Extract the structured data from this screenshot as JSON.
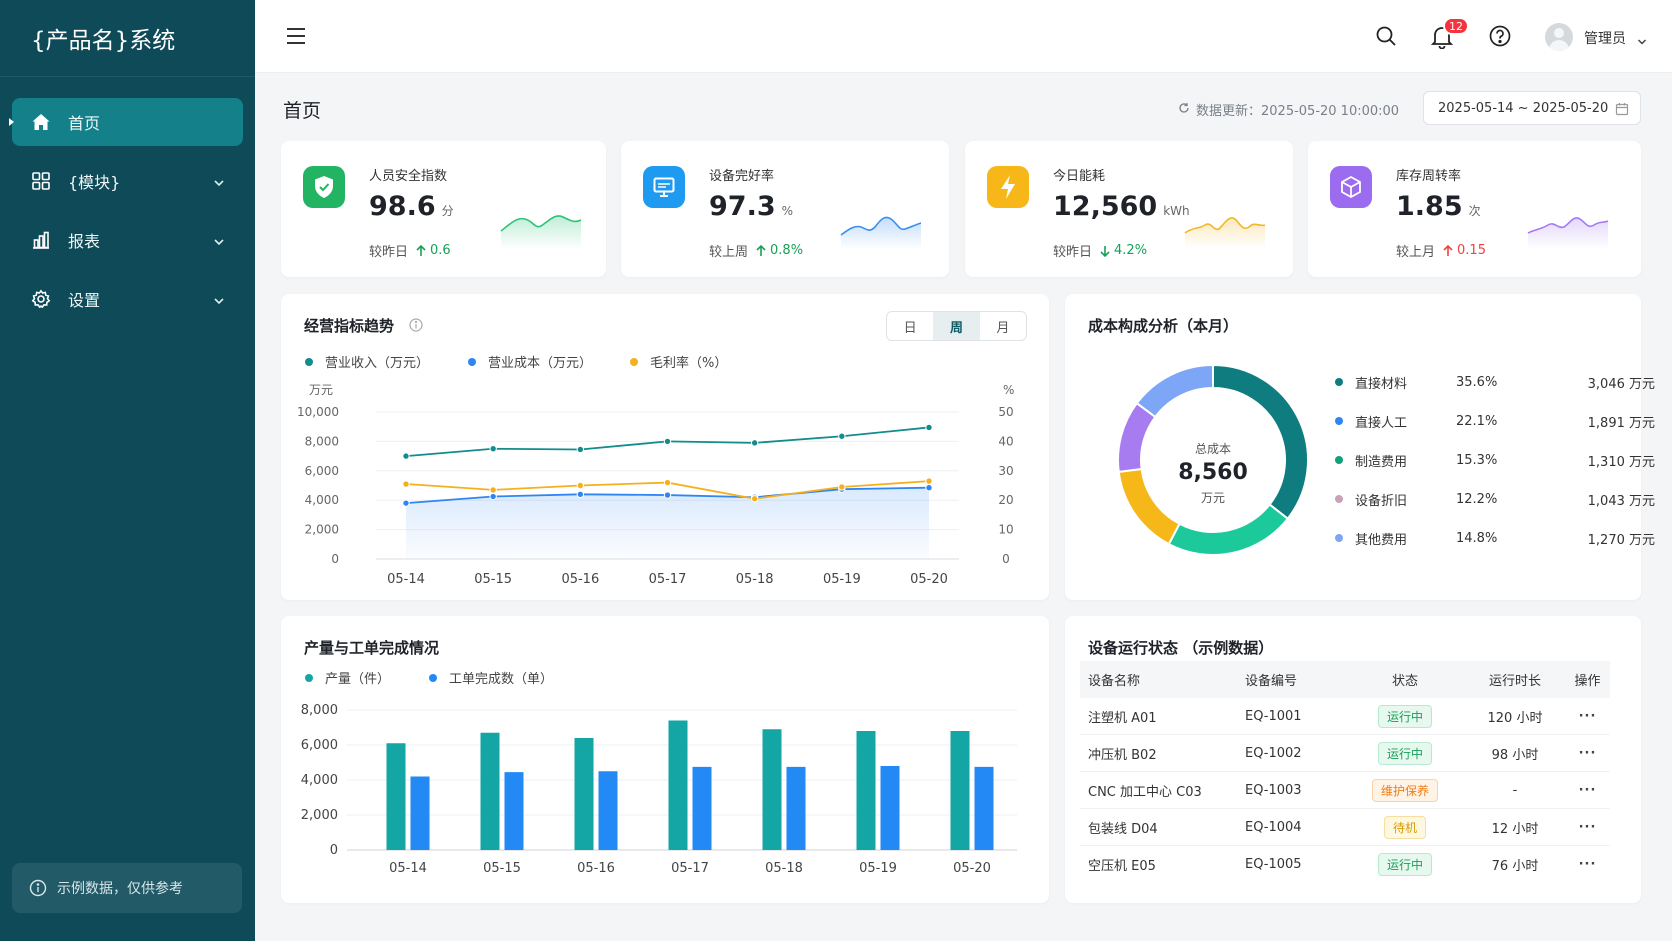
{
  "brand": {
    "title": "{产品名}系统"
  },
  "sidebar": {
    "items": [
      {
        "label": "首页",
        "icon": "home-icon",
        "active": true
      },
      {
        "label": "{模块}",
        "icon": "grid-icon"
      },
      {
        "label": "报表",
        "icon": "bar-chart-icon"
      },
      {
        "label": "设置",
        "icon": "gear-icon"
      }
    ],
    "footer": "示例数据，仅供参考"
  },
  "header": {
    "notification_count": "12",
    "user_name": "管理员"
  },
  "page": {
    "title": "首页",
    "update_text": "数据更新：2025-05-20 10:00:00",
    "date_range": "2025-05-14 ~ 2025-05-20"
  },
  "kpis": [
    {
      "label": "人员安全指数",
      "value": "98.6",
      "unit": "分",
      "compare": "较昨日",
      "delta": "0.6",
      "direction": "up",
      "delta_color": "#18a058",
      "icon": "shield-check-icon",
      "icon_bg": "#22b462",
      "spark_color": "#2cc27a"
    },
    {
      "label": "设备完好率",
      "value": "97.3",
      "unit": "%",
      "compare": "较上周",
      "delta": "0.8%",
      "direction": "up",
      "delta_color": "#18a058",
      "icon": "monitor-icon",
      "icon_bg": "#1e9bf0",
      "spark_color": "#3a8ef0"
    },
    {
      "label": "今日能耗",
      "value": "12,560",
      "unit": "kWh",
      "compare": "较昨日",
      "delta": "4.2%",
      "direction": "down",
      "delta_color": "#18a058",
      "icon": "lightning-icon",
      "icon_bg": "#f7b718",
      "spark_color": "#f4b626"
    },
    {
      "label": "库存周转率",
      "value": "1.85",
      "unit": "次",
      "compare": "较上月",
      "delta": "0.15",
      "direction": "up",
      "delta_color": "#f04141",
      "icon": "cube-icon",
      "icon_bg": "#9b6cf0",
      "spark_color": "#a47af2"
    }
  ],
  "trend": {
    "title": "经营指标趋势",
    "periods": [
      "日",
      "周",
      "月"
    ],
    "selected_period": "周",
    "left_unit": "万元",
    "right_unit": "%"
  },
  "production": {
    "title": "产量与工单完成情况"
  },
  "cost": {
    "title": "成本构成分析（本月）",
    "center_label": "总成本",
    "center_value": "8,560",
    "center_unit": "万元"
  },
  "equipment": {
    "title": "设备运行状态 （示例数据）",
    "columns": [
      "设备名称",
      "设备编号",
      "状态",
      "运行时长",
      "操作"
    ],
    "rows": [
      {
        "name": "注塑机 A01",
        "code": "EQ-1001",
        "status": "运行中",
        "status_type": "run",
        "hours": "120 小时",
        "action": "···"
      },
      {
        "name": "冲压机 B02",
        "code": "EQ-1002",
        "status": "运行中",
        "status_type": "run",
        "hours": "98 小时",
        "action": "···"
      },
      {
        "name": "CNC 加工中心 C03",
        "code": "EQ-1003",
        "status": "维护保养",
        "status_type": "maint",
        "hours": "-",
        "action": "···"
      },
      {
        "name": "包装线 D04",
        "code": "EQ-1004",
        "status": "待机",
        "status_type": "idle",
        "hours": "12 小时",
        "action": "···"
      },
      {
        "name": "空压机 E05",
        "code": "EQ-1005",
        "status": "运行中",
        "status_type": "run",
        "hours": "76 小时",
        "action": "···"
      }
    ]
  },
  "chart_data": [
    {
      "type": "line",
      "title": "经营指标趋势",
      "categories": [
        "05-14",
        "05-15",
        "05-16",
        "05-17",
        "05-18",
        "05-19",
        "05-20"
      ],
      "ylabel": "万元",
      "y2label": "%",
      "ylim": [
        0,
        10000
      ],
      "y2lim": [
        0,
        50
      ],
      "yticks": [
        "0",
        "2,000",
        "4,000",
        "6,000",
        "8,000",
        "10,000"
      ],
      "y2ticks": [
        "0",
        "10",
        "20",
        "30",
        "40",
        "50"
      ],
      "series": [
        {
          "name": "营业收入（万元）",
          "axis": "left",
          "color": "#128c8c",
          "values": [
            7000,
            7500,
            7450,
            8000,
            7900,
            8350,
            8950
          ]
        },
        {
          "name": "营业成本（万元）",
          "axis": "left",
          "color": "#2f86f2",
          "values": [
            3800,
            4250,
            4400,
            4350,
            4200,
            4750,
            4850
          ],
          "area": true
        },
        {
          "name": "毛利率（%）",
          "axis": "right",
          "color": "#f6b01e",
          "values": [
            25.5,
            23.5,
            25.0,
            26.0,
            20.5,
            24.5,
            26.5
          ]
        }
      ],
      "legend": "top-left",
      "grid": true
    },
    {
      "type": "bar",
      "title": "产量与工单完成情况",
      "categories": [
        "05-14",
        "05-15",
        "05-16",
        "05-17",
        "05-18",
        "05-19",
        "05-20"
      ],
      "ylim": [
        0,
        8000
      ],
      "yticks": [
        "0",
        "2,000",
        "4,000",
        "6,000",
        "8,000"
      ],
      "series": [
        {
          "name": "产量（件）",
          "color": "#14a5a5",
          "values": [
            6100,
            6700,
            6400,
            7400,
            6900,
            6800,
            6800
          ]
        },
        {
          "name": "工单完成数（单）",
          "color": "#2289f5",
          "values": [
            4200,
            4450,
            4500,
            4750,
            4750,
            4800,
            4750
          ]
        }
      ],
      "legend": "top-left",
      "grid": true
    },
    {
      "type": "pie",
      "title": "成本构成分析（本月）",
      "slices": [
        {
          "name": "直接材料",
          "percent": "35.6%",
          "value": 35.6,
          "amount": "3,046 万元",
          "color": "#0f7c80"
        },
        {
          "name": "直接人工",
          "percent": "22.1%",
          "value": 22.1,
          "amount": "1,891 万元",
          "color": "#1cc99a"
        },
        {
          "name": "制造费用",
          "percent": "15.3%",
          "value": 15.3,
          "amount": "1,310 万元",
          "color": "#f6b718"
        },
        {
          "name": "设备折旧",
          "percent": "12.2%",
          "value": 12.2,
          "amount": "1,043 万元",
          "color": "#a77cf0"
        },
        {
          "name": "其他费用",
          "percent": "14.8%",
          "value": 14.8,
          "amount": "1,270 万元",
          "color": "#7ea6f7"
        }
      ],
      "legend_colors": [
        "#0f7c80",
        "#2f86f2",
        "#14a07a",
        "#c9a2b5",
        "#7ea6f7"
      ],
      "legend": "right"
    }
  ]
}
